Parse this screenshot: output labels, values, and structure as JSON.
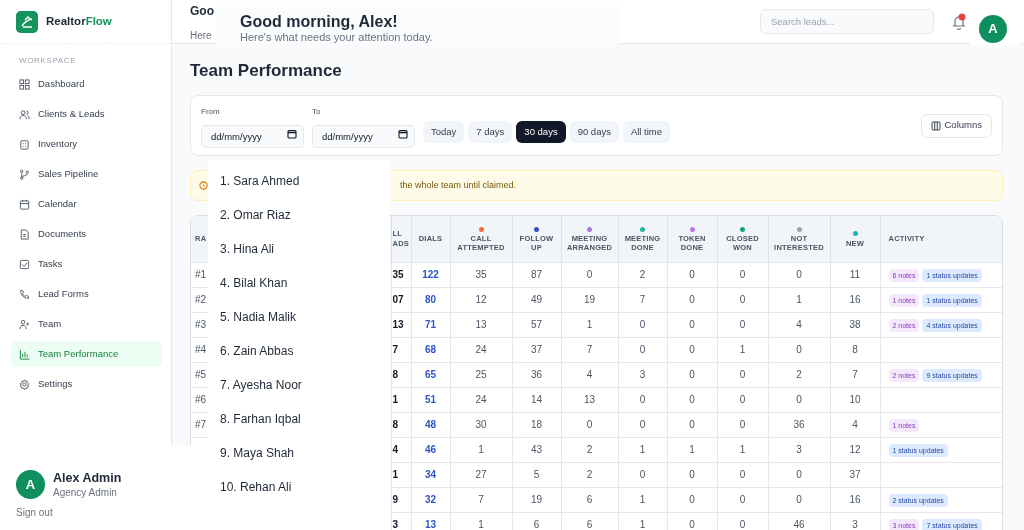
{
  "brand": {
    "part_1": "Realtor",
    "part_2": "Flow"
  },
  "sidebar": {
    "section": "WORKSPACE",
    "items": [
      {
        "label": "Dashboard",
        "selected": false
      },
      {
        "label": "Clients & Leads",
        "selected": false
      },
      {
        "label": "Inventory",
        "selected": false
      },
      {
        "label": "Sales Pipeline",
        "selected": false
      },
      {
        "label": "Calendar",
        "selected": false
      },
      {
        "label": "Documents",
        "selected": false
      },
      {
        "label": "Tasks",
        "selected": false
      },
      {
        "label": "Lead Forms",
        "selected": false
      },
      {
        "label": "Team",
        "selected": false
      },
      {
        "label": "Team Performance",
        "selected": true
      },
      {
        "label": "Settings",
        "selected": false
      }
    ]
  },
  "header": {
    "title_fragment": "Goo",
    "subtitle_fragment": "Here",
    "search": {
      "placeholder": "Search leads..."
    }
  },
  "greeting": {
    "title": "Good morning, Alex!",
    "subtitle": "Here's what needs your attention today."
  },
  "avatar": {
    "initial": "A"
  },
  "page_title": "Team Performance",
  "filters": {
    "fields": [
      {
        "label": "From",
        "placeholder": "dd/mm/yyyy"
      },
      {
        "label": "To",
        "placeholder": "dd/mm/yyyy"
      }
    ],
    "ranges": [
      {
        "label": "Today",
        "selected": false
      },
      {
        "label": "7 days",
        "selected": false
      },
      {
        "label": "30 days",
        "selected": true
      },
      {
        "label": "90 days",
        "selected": false
      },
      {
        "label": "All time",
        "selected": false
      }
    ],
    "columns_button": "Columns"
  },
  "alert": "the whole team until claimed.",
  "table": {
    "columns": [
      {
        "label": "RA"
      },
      {
        "label": "LL ADS"
      },
      {
        "label": "DIALS"
      },
      {
        "label": "CALL ATTEMPTED",
        "color": "#f26b3a"
      },
      {
        "label": "FOLLOW UP",
        "color": "#3b4cc0"
      },
      {
        "label": "MEETING ARRANGED",
        "color": "#a77bdc"
      },
      {
        "label": "MEETING DONE",
        "color": "#1fb89a"
      },
      {
        "label": "TOKEN DONE",
        "color": "#b57be0"
      },
      {
        "label": "CLOSED WON",
        "color": "#11a37f"
      },
      {
        "label": "NOT INTERESTED",
        "color": "#9ca3af"
      },
      {
        "label": "NEW",
        "color": "#22b5b0"
      },
      {
        "label": "ACTIVITY"
      }
    ],
    "rows": [
      {
        "rank": "#1",
        "leads": "35",
        "dials": "122",
        "values": [
          "35",
          "87",
          "0",
          "2",
          "0",
          "0",
          "0",
          "11"
        ],
        "activity": [
          {
            "kind": "notes",
            "text": "6 notes"
          },
          {
            "kind": "status",
            "text": "1 status updates"
          }
        ]
      },
      {
        "rank": "#2",
        "leads": "07",
        "dials": "80",
        "values": [
          "12",
          "49",
          "19",
          "7",
          "0",
          "0",
          "1",
          "16"
        ],
        "activity": [
          {
            "kind": "notes",
            "text": "1 notes"
          },
          {
            "kind": "status",
            "text": "1 status updates"
          }
        ]
      },
      {
        "rank": "#3",
        "leads": "13",
        "dials": "71",
        "values": [
          "13",
          "57",
          "1",
          "0",
          "0",
          "0",
          "4",
          "38"
        ],
        "activity": [
          {
            "kind": "notes",
            "text": "2 notes"
          },
          {
            "kind": "status",
            "text": "4 status updates"
          }
        ]
      },
      {
        "rank": "#4",
        "leads": "7",
        "dials": "68",
        "values": [
          "24",
          "37",
          "7",
          "0",
          "0",
          "1",
          "0",
          "8"
        ]
      },
      {
        "rank": "#5",
        "leads": "8",
        "dials": "65",
        "values": [
          "25",
          "36",
          "4",
          "3",
          "0",
          "0",
          "2",
          "7"
        ],
        "activity": [
          {
            "kind": "notes",
            "text": "2 notes"
          },
          {
            "kind": "status",
            "text": "9 status updates"
          }
        ]
      },
      {
        "rank": "#6",
        "leads": "1",
        "dials": "51",
        "values": [
          "24",
          "14",
          "13",
          "0",
          "0",
          "0",
          "0",
          "10"
        ]
      },
      {
        "rank": "#7",
        "leads": "8",
        "dials": "48",
        "values": [
          "30",
          "18",
          "0",
          "0",
          "0",
          "0",
          "36",
          "4"
        ],
        "activity": [
          {
            "kind": "notes",
            "text": "1 notes"
          }
        ]
      },
      {
        "leads": "4",
        "dials": "46",
        "values": [
          "1",
          "43",
          "2",
          "1",
          "1",
          "1",
          "3",
          "12"
        ],
        "activity": [
          {
            "kind": "status",
            "text": "1 status updates"
          }
        ]
      },
      {
        "leads": "1",
        "dials": "34",
        "values": [
          "27",
          "5",
          "2",
          "0",
          "0",
          "0",
          "0",
          "37"
        ]
      },
      {
        "leads": "9",
        "dials": "32",
        "values": [
          "7",
          "19",
          "6",
          "1",
          "0",
          "0",
          "0",
          "16"
        ],
        "activity": [
          {
            "kind": "status",
            "text": "2 status updates"
          }
        ]
      },
      {
        "leads": "3",
        "dials": "13",
        "values": [
          "1",
          "6",
          "6",
          "1",
          "0",
          "0",
          "46",
          "3"
        ],
        "activity": [
          {
            "kind": "notes",
            "text": "3 notes"
          },
          {
            "kind": "status",
            "text": "7 status updates"
          }
        ]
      }
    ]
  },
  "names_list": [
    "1. Sara Ahmed",
    "2. Omar Riaz",
    "3. Hina Ali",
    "4. Bilal Khan",
    "5. Nadia Malik",
    "6. Zain Abbas",
    "7. Ayesha Noor",
    "8. Farhan Iqbal",
    "9. Maya Shah",
    "10. Rehan Ali"
  ],
  "user": {
    "initial": "A",
    "name": "Alex Admin",
    "role": "Agency Admin",
    "sign_out": "Sign out"
  }
}
